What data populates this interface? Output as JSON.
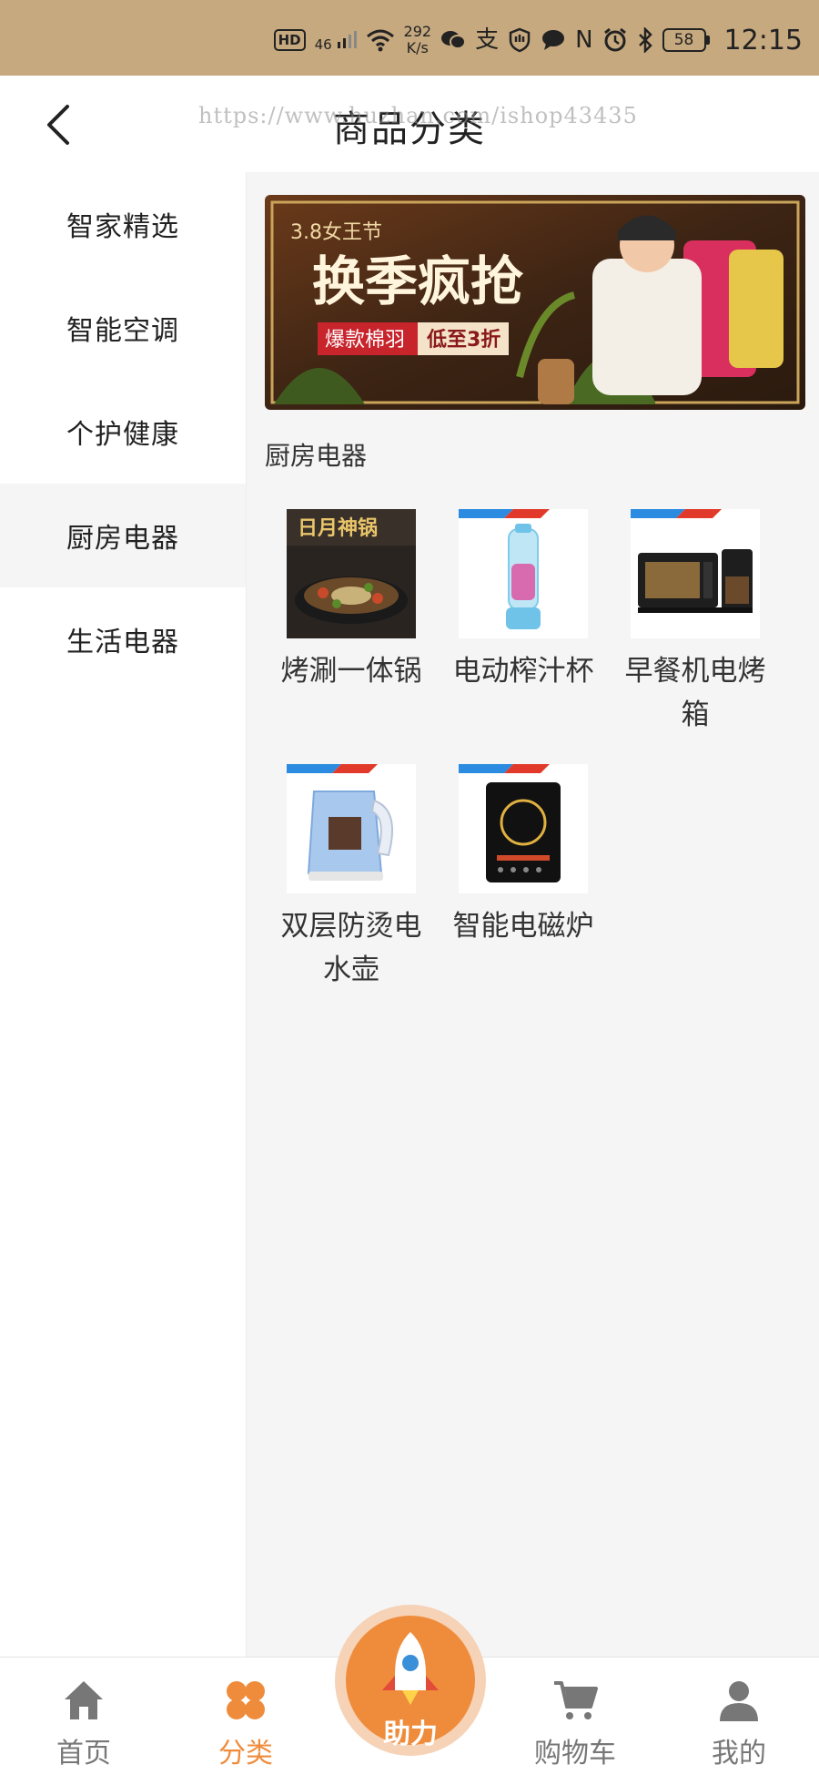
{
  "status_bar": {
    "hd": "HD",
    "signal": "46",
    "speed_value": "292",
    "speed_unit": "K/s",
    "nfc": "N",
    "battery": "58",
    "time": "12:15"
  },
  "header": {
    "title": "商品分类",
    "watermark": "https://www.huzhan.com/ishop43435"
  },
  "sidebar": {
    "items": [
      {
        "label": "智家精选"
      },
      {
        "label": "智能空调"
      },
      {
        "label": "个护健康"
      },
      {
        "label": "厨房电器"
      },
      {
        "label": "生活电器"
      }
    ],
    "active_index": 3
  },
  "banner": {
    "badge": "3.8女王节",
    "headline": "换季疯抢",
    "tag1": "爆款棉羽",
    "tag2": "低至3折"
  },
  "content": {
    "section_title": "厨房电器",
    "products": [
      {
        "name": "烤涮一体锅",
        "image_text": "日月神锅"
      },
      {
        "name": "电动榨汁杯"
      },
      {
        "name": "早餐机电烤箱"
      },
      {
        "name": "双层防烫电水壶"
      },
      {
        "name": "智能电磁炉"
      }
    ]
  },
  "tabbar": {
    "home": "首页",
    "category": "分类",
    "assist": "助力",
    "cart": "购物车",
    "mine": "我的"
  },
  "colors": {
    "accent": "#ef8c3c",
    "status_bar": "#c6a97f",
    "sidebar_active_bg": "#f5f5f5",
    "content_bg": "#f5f5f5"
  }
}
